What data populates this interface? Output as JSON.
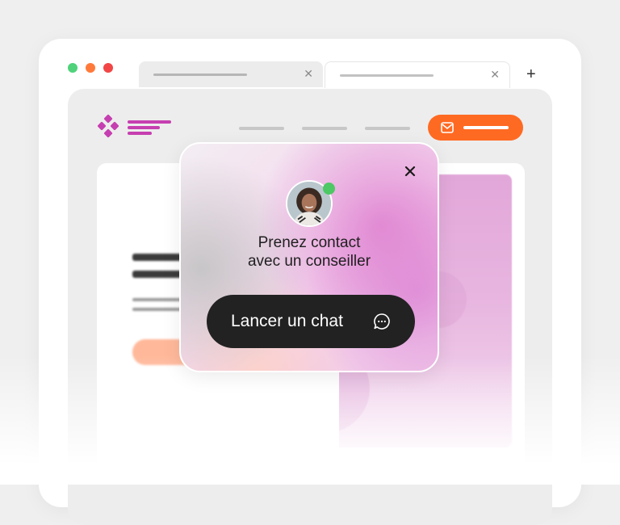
{
  "browser": {
    "window_controls": [
      "close",
      "minimize",
      "maximize"
    ],
    "tabs": [
      {
        "label": "",
        "active": false
      },
      {
        "label": "",
        "active": true
      }
    ],
    "new_tab_icon": "plus-icon",
    "tab_close_icon": "close-icon"
  },
  "site": {
    "logo_icon": "logo-icon",
    "nav_items": 3,
    "cta_icon": "mail-icon",
    "colors": {
      "brand": "#c63fb0",
      "cta": "#ff6a22"
    }
  },
  "chat_popup": {
    "close_icon": "close-icon",
    "avatar_icon": "advisor-avatar",
    "status": "online",
    "status_color": "#4cc864",
    "prompt_line1": "Prenez contact",
    "prompt_line2": "avec un conseiller",
    "button_label": "Lancer un chat",
    "button_icon": "chat-bubble-icon"
  }
}
